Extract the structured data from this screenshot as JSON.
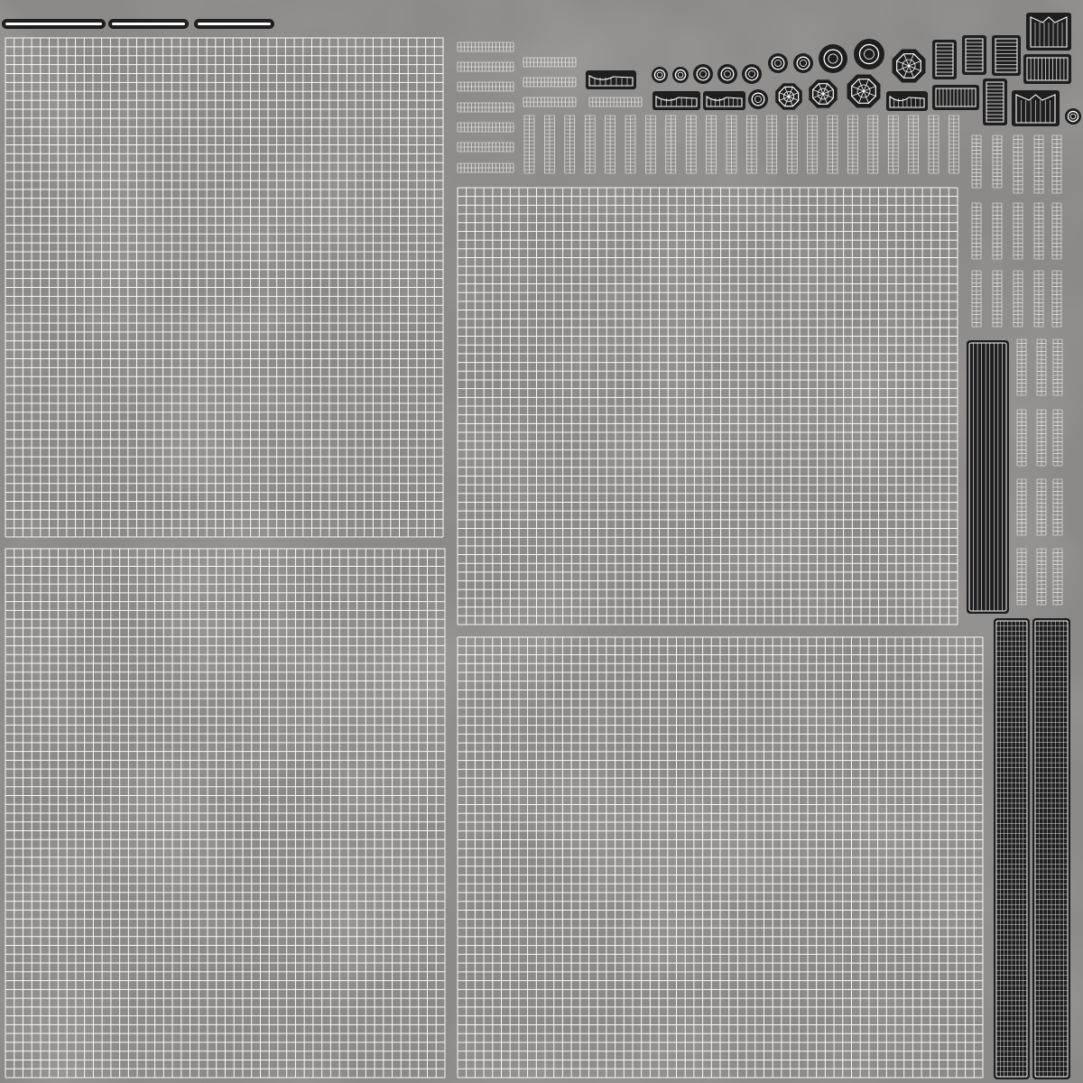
{
  "texture": {
    "background_color": "#8c8a88",
    "wire_color": "#ffffff",
    "dark_fill_color": "#1e1e1e"
  },
  "icons": [
    "dark-bar",
    "grid-panel",
    "small-grid-strip",
    "vertical-grid-strip",
    "ring-icon",
    "octagon-web-icon",
    "arch-icon",
    "louver-icon",
    "dark-column-panel"
  ]
}
